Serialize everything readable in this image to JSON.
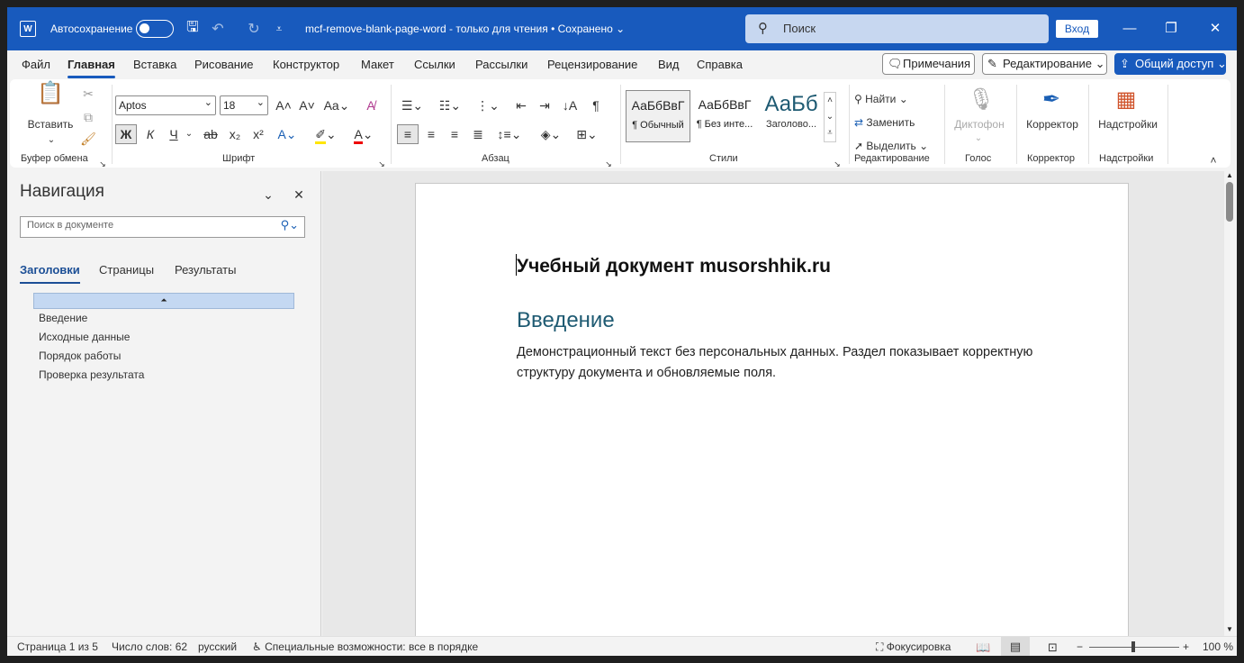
{
  "titlebar": {
    "app_icon": "W",
    "autosave_label": "Автосохранение",
    "doc_title": "mcf-remove-blank-page-word  -  только для чтения • Сохранено ⌄",
    "search_placeholder": "Поиск",
    "login_label": "Вход",
    "minimize_icon": "—",
    "restore_icon": "❐",
    "close_icon": "✕",
    "save_icon": "🖫",
    "undo_icon": "↶",
    "redo_icon": "↻",
    "customize_icon": "⩡"
  },
  "menu": {
    "tabs": [
      "Файл",
      "Главная",
      "Вставка",
      "Рисование",
      "Конструктор",
      "Макет",
      "Ссылки",
      "Рассылки",
      "Рецензирование",
      "Вид",
      "Справка"
    ],
    "comments_label": "Примечания",
    "editing_label": "Редактирование",
    "share_label": "Общий доступ"
  },
  "ribbon": {
    "paste_label": "Вставить",
    "font_name": "Aptos",
    "font_size": "18",
    "bold": "Ж",
    "italic": "К",
    "underline": "Ч",
    "styles": [
      {
        "preview": "АаБбВвГ",
        "name": "¶ Обычный"
      },
      {
        "preview": "АаБбВвГ",
        "name": "¶ Без инте..."
      },
      {
        "preview": "АаБб",
        "name": "Заголово..."
      }
    ],
    "find_label": "Найти",
    "replace_label": "Заменить",
    "select_label": "Выделить",
    "dictate_label": "Диктофон",
    "editor_label": "Корректор",
    "addins_label": "Надстройки",
    "groups": {
      "clipboard": "Буфер обмена",
      "font": "Шрифт",
      "paragraph": "Абзац",
      "styles": "Стили",
      "editing": "Редактирование",
      "voice": "Голос",
      "editor": "Корректор",
      "addins": "Надстройки"
    }
  },
  "nav": {
    "title": "Навигация",
    "search_placeholder": "Поиск в документе",
    "tabs": [
      "Заголовки",
      "Страницы",
      "Результаты"
    ],
    "headings": [
      "Введение",
      "Исходные данные",
      "Порядок работы",
      "Проверка результата"
    ]
  },
  "document": {
    "title": "Учебный документ musorshhik.ru",
    "heading": "Введение",
    "paragraph": "Демонстрационный текст без персональных данных. Раздел показывает корректную структуру документа и обновляемые поля."
  },
  "status": {
    "page": "Страница 1 из 5",
    "words": "Число слов: 62",
    "language": "русский",
    "accessibility": "Специальные возможности: все в порядке",
    "focus": "Фокусировка",
    "zoom_level": "100 %"
  }
}
